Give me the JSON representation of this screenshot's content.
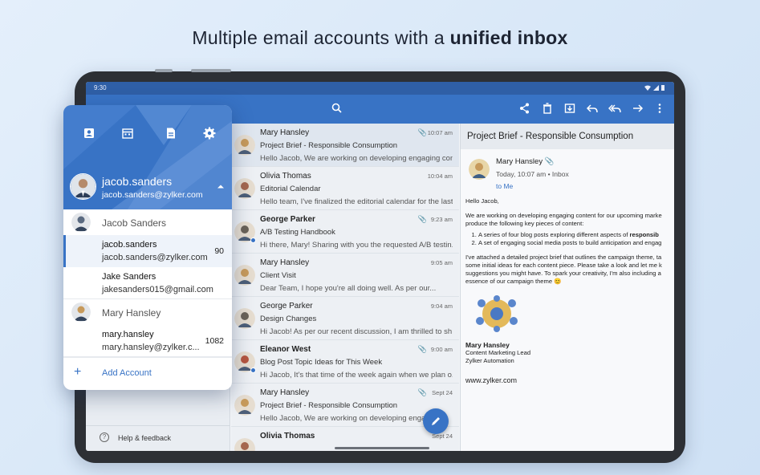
{
  "headline": {
    "prefix": "Multiple email accounts with a ",
    "emphasis": "unified inbox"
  },
  "status": {
    "time": "9:30"
  },
  "colors": {
    "accent": "#3873c5",
    "statusbar": "#2f5fa6"
  },
  "toolbar": {
    "icons": [
      "search-icon",
      "share-icon",
      "trash-icon",
      "move-icon",
      "reply-icon",
      "reply-all-icon",
      "forward-icon",
      "more-icon"
    ]
  },
  "sidebar": {
    "help_label": "Help & feedback"
  },
  "mails": [
    {
      "from": "Mary Hansley",
      "subject": "Project Brief - Responsible Consumption",
      "preview": "Hello Jacob, We are working on developing engaging con...",
      "time": "10:07 am",
      "attachment": true,
      "unread": false,
      "selected": true,
      "avatar": "#c79a5b"
    },
    {
      "from": "Olivia Thomas",
      "subject": "Editorial Calendar",
      "preview": "Hello team, I've finalized the editorial calendar for the last...",
      "time": "10:04 am",
      "attachment": false,
      "unread": false,
      "selected": false,
      "avatar": "#a5674f"
    },
    {
      "from": "George Parker",
      "subject": "A/B Testing Handbook",
      "preview": "Hi there, Mary! Sharing with you the requested A/B testin...",
      "time": "9:23 am",
      "attachment": true,
      "unread": true,
      "selected": false,
      "avatar": "#6a6258"
    },
    {
      "from": "Mary Hansley",
      "subject": "Client Visit",
      "preview": "Dear Team, I hope you're all doing well. As per our...",
      "time": "9:05 am",
      "attachment": false,
      "unread": false,
      "selected": false,
      "avatar": "#c79a5b"
    },
    {
      "from": "George Parker",
      "subject": "Design Changes",
      "preview": "Hi Jacob! As per our recent discussion, I am thrilled to sh...",
      "time": "9:04 am",
      "attachment": false,
      "unread": false,
      "selected": false,
      "avatar": "#6a6258"
    },
    {
      "from": "Eleanor West",
      "subject": "Blog Post Topic Ideas for This Week",
      "preview": "Hi Jacob, It's that time of the week again when we plan o...",
      "time": "9:00 am",
      "attachment": true,
      "unread": true,
      "selected": false,
      "avatar": "#b5553f"
    },
    {
      "from": "Mary Hansley",
      "subject": "Project Brief - Responsible Consumption",
      "preview": "Hello Jacob, We are working on developing engaging...",
      "time": "Sept 24",
      "attachment": true,
      "unread": false,
      "selected": false,
      "avatar": "#c79a5b"
    },
    {
      "from": "Olivia Thomas",
      "subject": "",
      "preview": "",
      "time": "Sept 24",
      "attachment": false,
      "unread": true,
      "selected": false,
      "avatar": "#a5674f"
    }
  ],
  "reader": {
    "title": "Project Brief - Responsible Consumption",
    "from": "Mary Hansley",
    "date": "Today, 10:07 am",
    "folder": "Inbox",
    "to": "to Me",
    "greeting": "Hello Jacob,",
    "para1a": "We are working on developing engaging content for our upcoming marke",
    "para1b": "produce the following key pieces of content:",
    "item1a": "A series of four blog posts exploring different aspects of ",
    "item1b": "responsib",
    "item2": "A set of engaging social media posts to build anticipation and engag",
    "para2a": "I've attached a detailed project brief that outlines the campaign theme, ta",
    "para2b": "some initial ideas for each content piece. Please take a look and let me k",
    "para2c": "suggestions you might have. To spark your creativity, I'm also including a",
    "para2d": "essence of our campaign theme 😊",
    "sig_name": "Mary Hansley",
    "sig_role": "Content Marketing Lead",
    "sig_company": "Zylker Automation",
    "website": "www.zylker.com"
  },
  "popup": {
    "icons": [
      "contacts-icon",
      "calendar-icon",
      "notes-icon",
      "settings-icon"
    ],
    "current_name": "jacob.sanders",
    "current_email": "jacob.sanders@zylker.com",
    "groups": [
      {
        "name": "Jacob Sanders",
        "avatar": "#5a6a80",
        "accounts": [
          {
            "name": "jacob.sanders",
            "email": "jacob.sanders@zylker.com",
            "count": "90",
            "selected": true
          },
          {
            "name": "Jake Sanders",
            "email": "jakesanders015@gmail.com",
            "count": "",
            "selected": false
          }
        ]
      },
      {
        "name": "Mary Hansley",
        "avatar": "#c79a5b",
        "accounts": [
          {
            "name": "mary.hansley",
            "email": "mary.hansley@zylker.c...",
            "count": "1082",
            "selected": false
          }
        ]
      }
    ],
    "add_label": "Add Account"
  }
}
